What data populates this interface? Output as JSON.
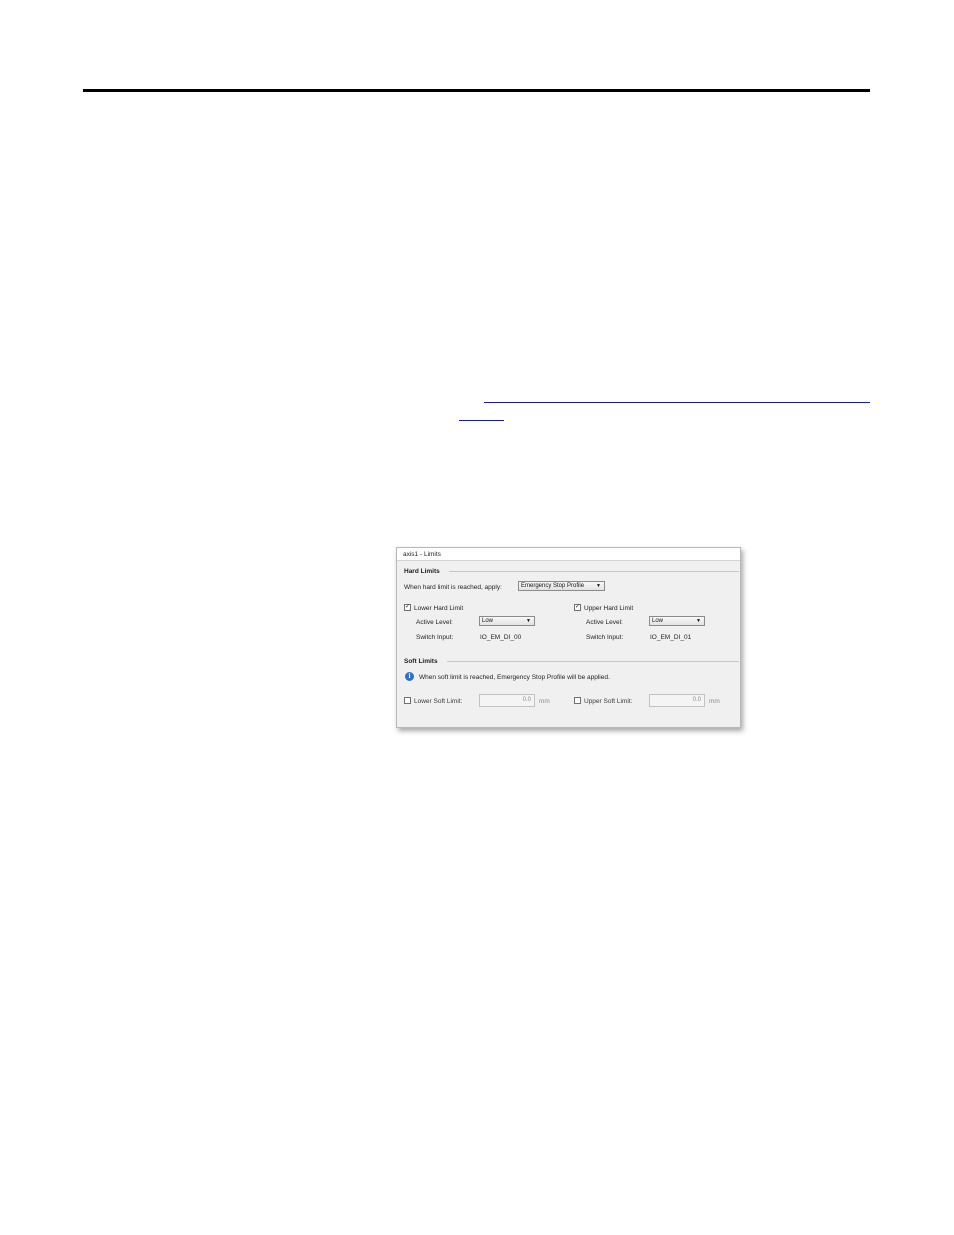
{
  "dialog": {
    "title": "axis1 - Limits",
    "hard_limits": {
      "section_title": "Hard Limits",
      "apply_label": "When hard limit is reached, apply:",
      "apply_value": "Emergency Stop Profile",
      "lower": {
        "label": "Lower Hard Limit",
        "checked": true,
        "active_level_label": "Active Level:",
        "active_level_value": "Low",
        "switch_input_label": "Switch Input:",
        "switch_input_value": "IO_EM_DI_00"
      },
      "upper": {
        "label": "Upper Hard Limit",
        "checked": true,
        "active_level_label": "Active Level:",
        "active_level_value": "Low",
        "switch_input_label": "Switch Input:",
        "switch_input_value": "IO_EM_DI_01"
      }
    },
    "soft_limits": {
      "section_title": "Soft Limits",
      "info_text": "When soft limit is reached, Emergency Stop Profile will be applied.",
      "lower": {
        "label": "Lower Soft Limit:",
        "checked": false,
        "value": "0.0",
        "unit": "mm"
      },
      "upper": {
        "label": "Upper Soft Limit:",
        "checked": false,
        "value": "0.0",
        "unit": "mm"
      }
    }
  },
  "icons": {
    "check": "✓",
    "dropdown": "▼",
    "info": "i"
  }
}
